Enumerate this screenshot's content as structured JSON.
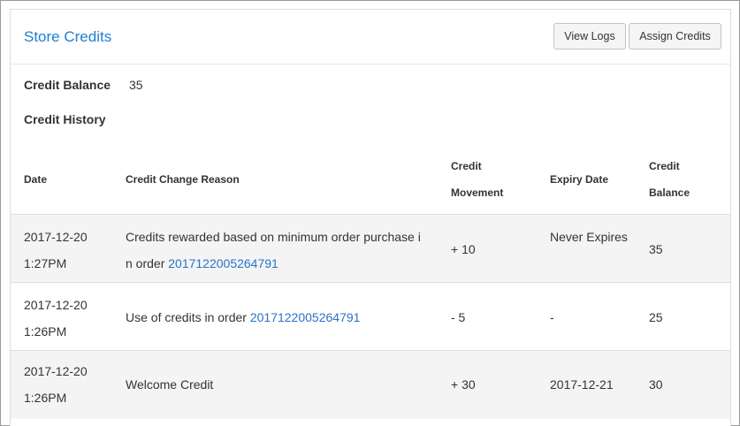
{
  "panel": {
    "title": "Store Credits",
    "view_logs_label": "View Logs",
    "assign_credits_label": "Assign Credits"
  },
  "balance": {
    "label": "Credit Balance",
    "value": "35"
  },
  "history": {
    "title": "Credit History",
    "columns": {
      "date": "Date",
      "reason": "Credit Change Reason",
      "movement_line1": "Credit",
      "movement_line2": "Movement",
      "expiry": "Expiry Date",
      "balance_line1": "Credit",
      "balance_line2": "Balance"
    },
    "rows": [
      {
        "date": "2017-12-20",
        "time": "1:27PM",
        "reason_text": "Credits rewarded based on minimum order purchase in order ",
        "order_link": "2017122005264791",
        "movement": "+ 10",
        "expiry": "Never Expires",
        "balance": "35"
      },
      {
        "date": "2017-12-20",
        "time": "1:26PM",
        "reason_text": "Use of credits in order ",
        "order_link": "2017122005264791",
        "movement": "- 5",
        "expiry": "-",
        "balance": "25"
      },
      {
        "date": "2017-12-20",
        "time": "1:26PM",
        "reason_text": "Welcome Credit",
        "order_link": "",
        "movement": "+ 30",
        "expiry": "2017-12-21",
        "balance": "30"
      }
    ]
  }
}
